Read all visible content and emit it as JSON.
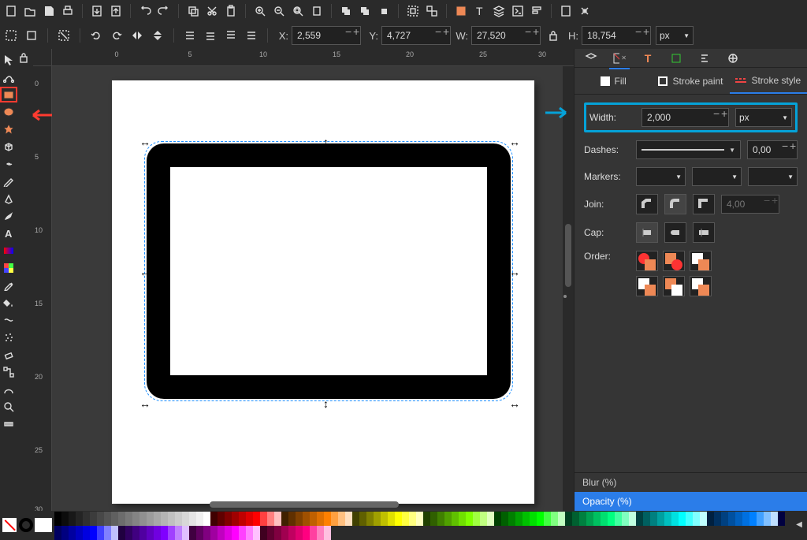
{
  "coords": {
    "x_label": "X:",
    "x": "2,559",
    "y_label": "Y:",
    "y": "4,727",
    "w_label": "W:",
    "w": "27,520",
    "h_label": "H:",
    "h": "18,754",
    "unit": "px"
  },
  "ruler_top": [
    "0",
    "5",
    "10",
    "15",
    "20",
    "25",
    "30"
  ],
  "ruler_left": [
    "0",
    "5",
    "10",
    "15",
    "20",
    "25",
    "30"
  ],
  "fillstroke": {
    "fill": "Fill",
    "stroke_paint": "Stroke paint",
    "stroke_style": "Stroke style"
  },
  "stroke": {
    "width_label": "Width:",
    "width_value": "2,000",
    "width_unit": "px",
    "dashes_label": "Dashes:",
    "dashes_value": "0,00",
    "markers_label": "Markers:",
    "join_label": "Join:",
    "join_value": "4,00",
    "cap_label": "Cap:",
    "order_label": "Order:"
  },
  "bottom": {
    "blur": "Blur (%)",
    "opacity": "Opacity (%)"
  },
  "palette": {
    "grays": [
      "#000",
      "#0c0c0c",
      "#181818",
      "#242424",
      "#303030",
      "#3c3c3c",
      "#484848",
      "#545454",
      "#606060",
      "#6c6c6c",
      "#787878",
      "#848484",
      "#909090",
      "#9c9c9c",
      "#a8a8a8",
      "#b4b4b4",
      "#c0c0c0",
      "#ccc",
      "#d8d8d8",
      "#e4e4e4",
      "#f0f0f0",
      "#fff"
    ],
    "hues": [
      "#400000",
      "#600000",
      "#800000",
      "#a00000",
      "#c00000",
      "#e00000",
      "#ff0000",
      "#ff4040",
      "#ff8080",
      "#ffc0c0",
      "#402000",
      "#603000",
      "#804000",
      "#a05000",
      "#c06000",
      "#e07000",
      "#ff8000",
      "#ffa040",
      "#ffc080",
      "#ffe0c0",
      "#404000",
      "#606000",
      "#808000",
      "#a0a000",
      "#c0c000",
      "#e0e000",
      "#ffff00",
      "#ffff40",
      "#ffff80",
      "#ffffc0",
      "#204000",
      "#306000",
      "#408000",
      "#50a000",
      "#60c000",
      "#70e000",
      "#80ff00",
      "#a0ff40",
      "#c0ff80",
      "#e0ffc0",
      "#004000",
      "#006000",
      "#008000",
      "#00a000",
      "#00c000",
      "#00e000",
      "#00ff00",
      "#40ff40",
      "#80ff80",
      "#c0ffc0",
      "#004020",
      "#006030",
      "#008040",
      "#00a050",
      "#00c060",
      "#00e070",
      "#00ff80",
      "#40ffa0",
      "#80ffc0",
      "#c0ffe0",
      "#004040",
      "#006060",
      "#008080",
      "#00a0a0",
      "#00c0c0",
      "#00e0e0",
      "#00ffff",
      "#40ffff",
      "#80ffff",
      "#c0ffff",
      "#002040",
      "#003060",
      "#004080",
      "#0050a0",
      "#0060c0",
      "#0070e0",
      "#0080ff",
      "#40a0ff",
      "#80c0ff",
      "#c0e0ff",
      "#000040",
      "#000060",
      "#000080",
      "#0000a0",
      "#0000c0",
      "#0000e0",
      "#0000ff",
      "#4040ff",
      "#8080ff",
      "#c0c0ff",
      "#200040",
      "#300060",
      "#400080",
      "#5000a0",
      "#6000c0",
      "#7000e0",
      "#8000ff",
      "#a040ff",
      "#c080ff",
      "#e0c0ff",
      "#400040",
      "#600060",
      "#800080",
      "#a000a0",
      "#c000c0",
      "#e000e0",
      "#ff00ff",
      "#ff40ff",
      "#ff80ff",
      "#ffc0ff",
      "#400020",
      "#600030",
      "#800040",
      "#a00050",
      "#c00060",
      "#e00070",
      "#ff0080",
      "#ff40a0",
      "#ff80c0",
      "#ffc0e0"
    ]
  }
}
